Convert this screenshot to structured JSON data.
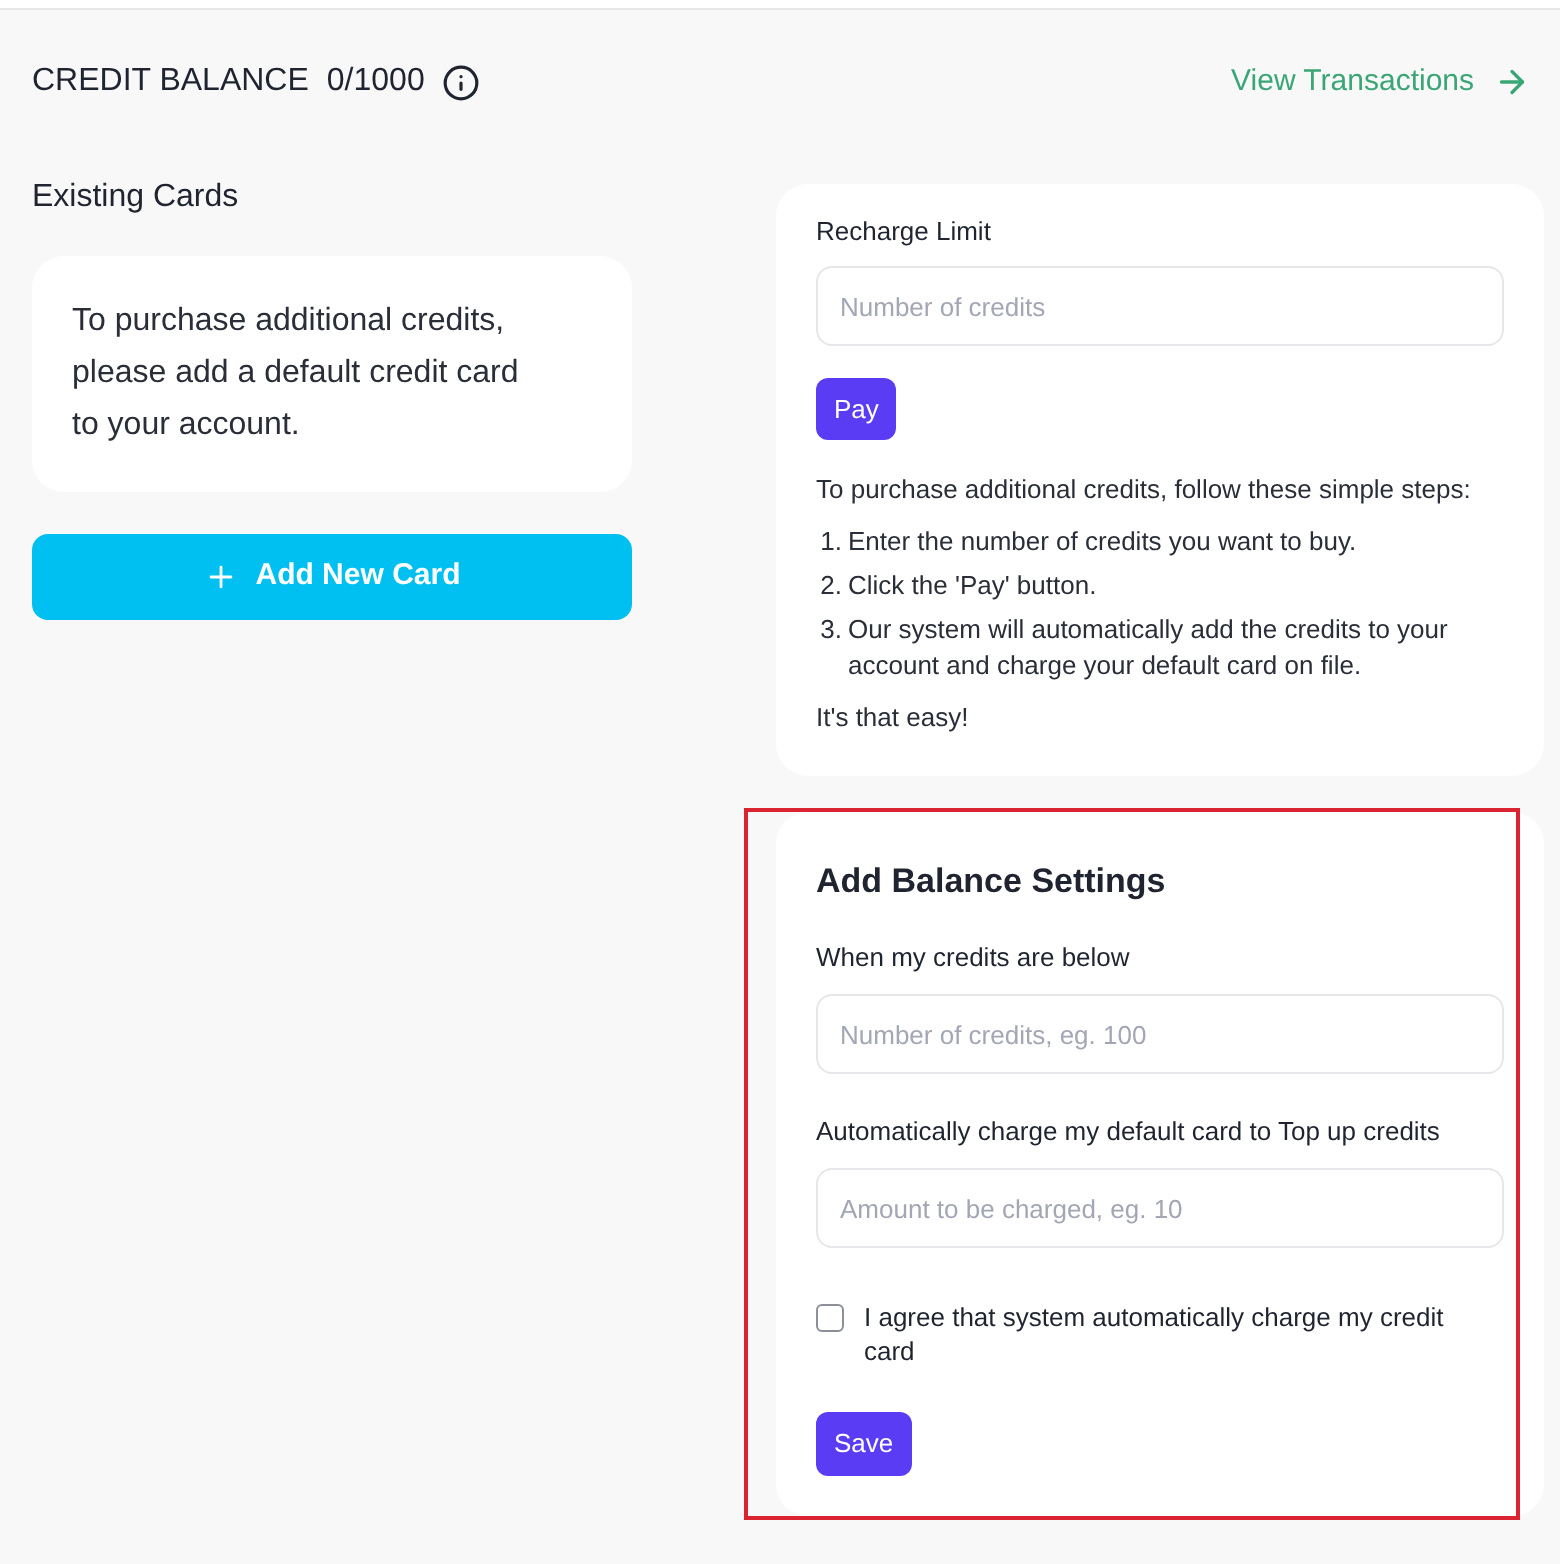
{
  "header": {
    "title": "CREDIT BALANCE",
    "balance": "0/1000",
    "link": "View Transactions"
  },
  "existing_cards": {
    "title": "Existing Cards",
    "empty_message": "To purchase additional credits, please add a default credit card to your account.",
    "add_button": "Add New Card"
  },
  "recharge": {
    "label": "Recharge Limit",
    "input": {
      "placeholder": "Number of credits"
    },
    "pay_button": "Pay",
    "intro": "To purchase additional credits, follow these simple steps:",
    "steps": [
      {
        "number": "1.",
        "text": "Enter the number of credits you want to buy."
      },
      {
        "number": "2.",
        "text": "Click the 'Pay' button."
      },
      {
        "number": "3.",
        "text": "Our system will automatically add the credits to your account and charge your default card on file."
      }
    ],
    "outro": "It's that easy!"
  },
  "balance_settings": {
    "highlighted": true,
    "title": "Add Balance Settings",
    "fields": [
      {
        "label": "When my credits are below",
        "placeholder": "Number of credits, eg. 100"
      },
      {
        "label": "Automatically charge my default card to Top up credits",
        "placeholder": "Amount to be charged, eg. 10"
      }
    ],
    "agree": {
      "label": "I agree that system automatically charge my credit card",
      "checked": false
    },
    "save_button": "Save"
  }
}
